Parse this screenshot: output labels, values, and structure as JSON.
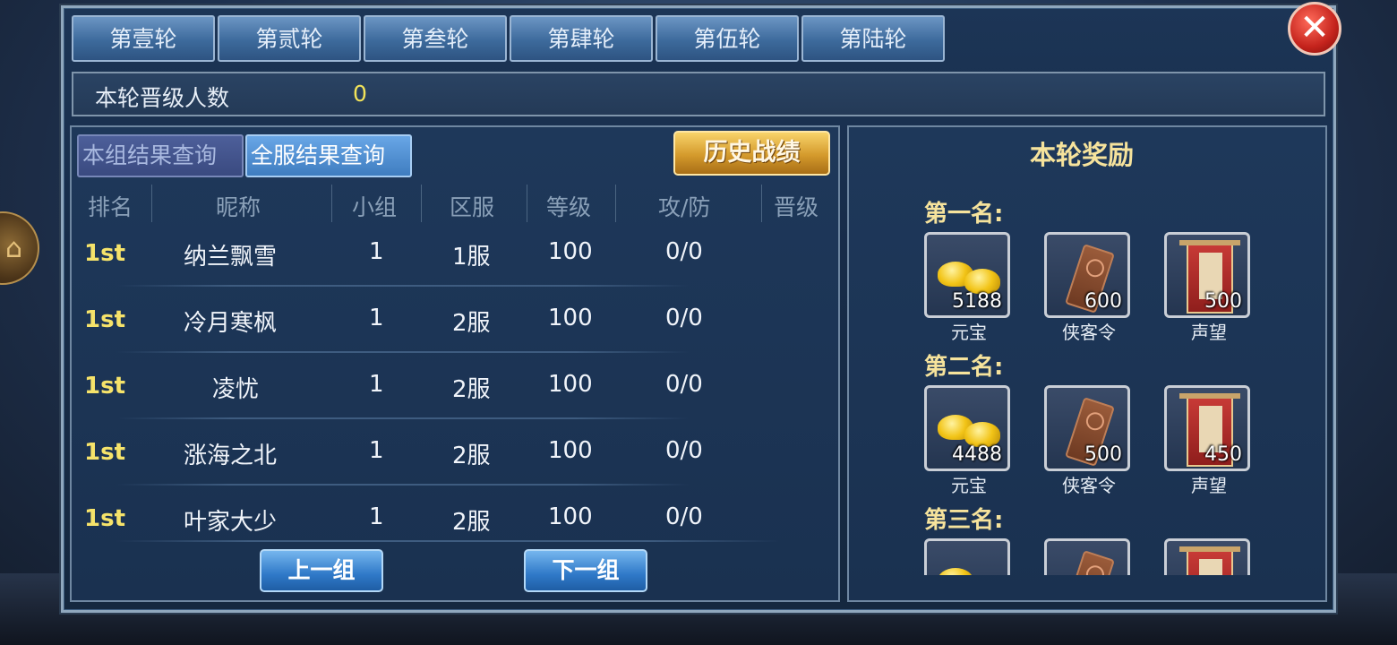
{
  "tabs": [
    "第壹轮",
    "第贰轮",
    "第叁轮",
    "第肆轮",
    "第伍轮",
    "第陆轮"
  ],
  "promotion": {
    "label": "本轮晋级人数",
    "value": "0"
  },
  "subtabs": {
    "group": "本组结果查询",
    "server": "全服结果查询"
  },
  "history_button": "历史战绩",
  "columns": [
    "排名",
    "昵称",
    "小组",
    "区服",
    "等级",
    "攻/防",
    "晋级"
  ],
  "rows": [
    {
      "rank": "1st",
      "name": "纳兰飘雪",
      "group": "1",
      "server": "1服",
      "level": "100",
      "atkdef": "0/0"
    },
    {
      "rank": "1st",
      "name": "冷月寒枫",
      "group": "1",
      "server": "2服",
      "level": "100",
      "atkdef": "0/0"
    },
    {
      "rank": "1st",
      "name": "凌忧",
      "group": "1",
      "server": "2服",
      "level": "100",
      "atkdef": "0/0"
    },
    {
      "rank": "1st",
      "name": "涨海之北",
      "group": "1",
      "server": "2服",
      "level": "100",
      "atkdef": "0/0"
    },
    {
      "rank": "1st",
      "name": "叶家大少",
      "group": "1",
      "server": "2服",
      "level": "100",
      "atkdef": "0/0"
    }
  ],
  "nav": {
    "prev": "上一组",
    "next": "下一组"
  },
  "rewards": {
    "title": "本轮奖励",
    "places": [
      {
        "label": "第一名:",
        "items": [
          {
            "name": "元宝",
            "qty": "5188",
            "icon": "gold-ingot-icon"
          },
          {
            "name": "侠客令",
            "qty": "600",
            "icon": "token-icon"
          },
          {
            "name": "声望",
            "qty": "500",
            "icon": "banner-icon"
          }
        ]
      },
      {
        "label": "第二名:",
        "items": [
          {
            "name": "元宝",
            "qty": "4488",
            "icon": "gold-ingot-icon"
          },
          {
            "name": "侠客令",
            "qty": "500",
            "icon": "token-icon"
          },
          {
            "name": "声望",
            "qty": "450",
            "icon": "banner-icon"
          }
        ]
      },
      {
        "label": "第三名:",
        "items": [
          {
            "name": "元宝",
            "qty": "",
            "icon": "gold-ingot-icon"
          },
          {
            "name": "侠客令",
            "qty": "",
            "icon": "token-icon"
          },
          {
            "name": "声望",
            "qty": "",
            "icon": "banner-icon"
          }
        ]
      }
    ]
  },
  "colors": {
    "rank": "#f6e36a",
    "reward_title": "#f6e39c",
    "promotion_value": "#f2e35a"
  }
}
